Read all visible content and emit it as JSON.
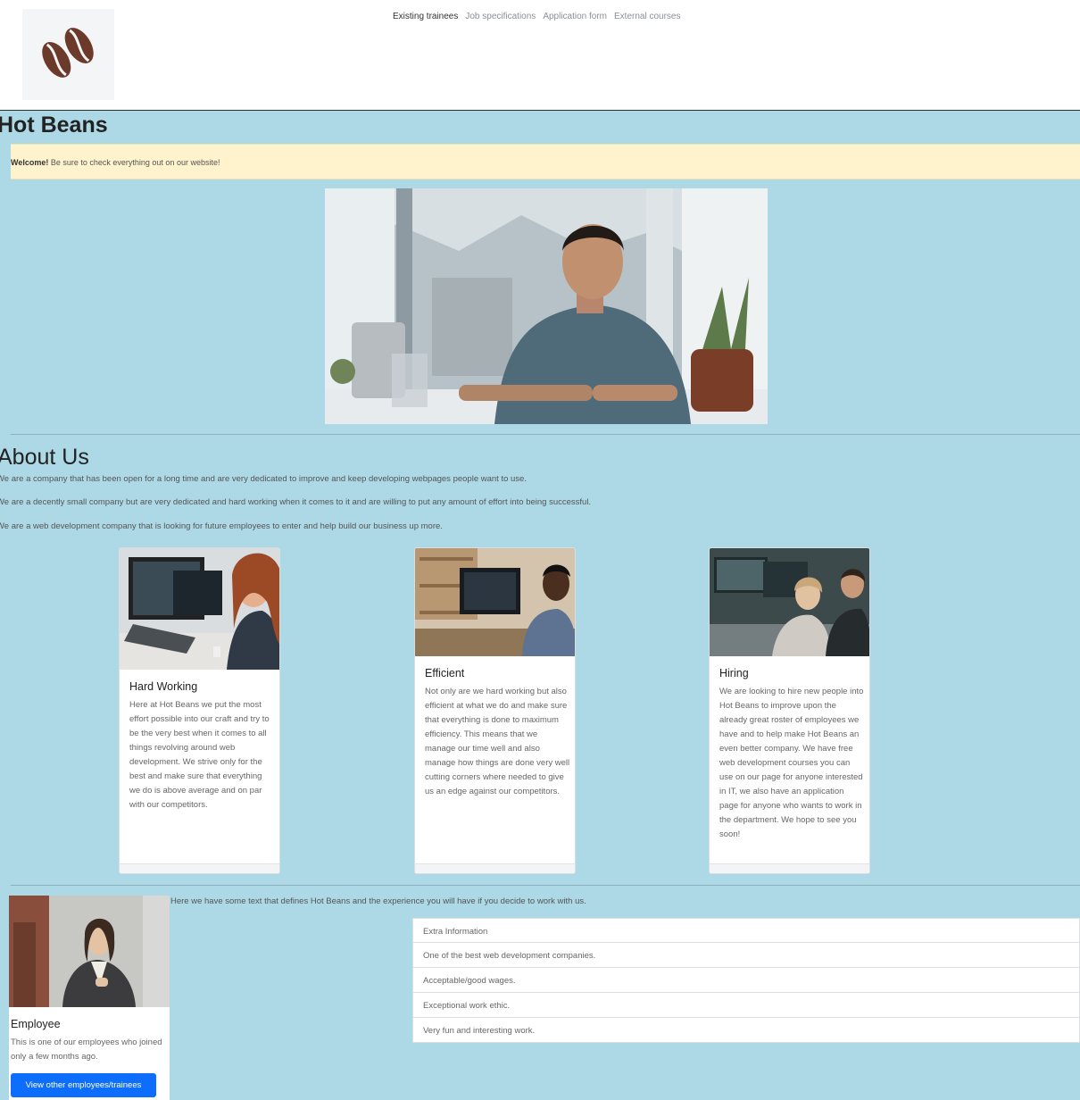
{
  "nav": {
    "items": [
      {
        "label": "Existing trainees",
        "active": true
      },
      {
        "label": "Job specifications",
        "active": false
      },
      {
        "label": "Application form",
        "active": false
      },
      {
        "label": "External courses",
        "active": false
      }
    ]
  },
  "header": {
    "title": "Hot Beans"
  },
  "alert": {
    "strong": "Welcome!",
    "text": " Be sure to check everything out on our website!"
  },
  "about": {
    "title": "About Us",
    "paragraphs": [
      "We are a company that has been open for a long time and are very dedicated to improve and keep developing webpages people want to use.",
      "We are a decently small company but are very dedicated and hard working when it comes to it and are willing to put any amount of effort into being successful.",
      "We are a web development company that is looking for future employees to enter and help build our business up more."
    ]
  },
  "cards": [
    {
      "title": "Hard Working",
      "text": "Here at Hot Beans we put the most effort possible into our craft and try to be the very best when it comes to all things revolving around web development. We strive only for the best and make sure that everything we do is above average and on par with our competitors."
    },
    {
      "title": "Efficient",
      "text": "Not only are we hard working but also efficient at what we do and make sure that everything is done to maximum efficiency. This means that we manage our time well and also manage how things are done very well cutting corners where needed to give us an edge against our competitors."
    },
    {
      "title": "Hiring",
      "text": "We are looking to hire new people into Hot Beans to improve upon the already great roster of employees we have and to help make Hot Beans an even better company. We have free web development courses you can use on our page for anyone interested in IT, we also have an application page for anyone who wants to work in the department. We hope to see you soon!"
    }
  ],
  "employee": {
    "title": "Employee",
    "text": "This is one of our employees who joined only a few months ago.",
    "button": "View other employees/trainees"
  },
  "info": {
    "intro": "Here we have some text that defines Hot Beans and the experience you will have if you decide to work with us.",
    "list": [
      "Extra Information",
      "One of the best web development companies.",
      "Acceptable/good wages.",
      "Exceptional work ethic.",
      "Very fun and interesting work."
    ]
  }
}
